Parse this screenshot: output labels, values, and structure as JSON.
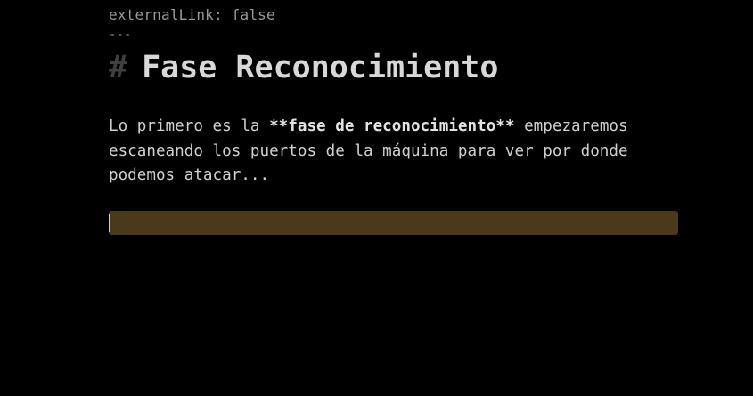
{
  "frontmatter": {
    "line": "externalLink: false",
    "delimiter": "---"
  },
  "heading": {
    "marker": "#",
    "text": "Fase Reconocimiento"
  },
  "paragraph": {
    "line1_pre": "Lo primero es la ",
    "line1_bold": "**fase de reconocimiento**",
    "line1_post": " empezaremos",
    "line2": "escaneando los puertos de la máquina para ver por donde",
    "line3": "podemos atacar..."
  },
  "colors": {
    "background": "#000000",
    "active_line": "#4b3a1a",
    "heading_marker": "#3f3f3f",
    "text": "#cfcfcf"
  }
}
